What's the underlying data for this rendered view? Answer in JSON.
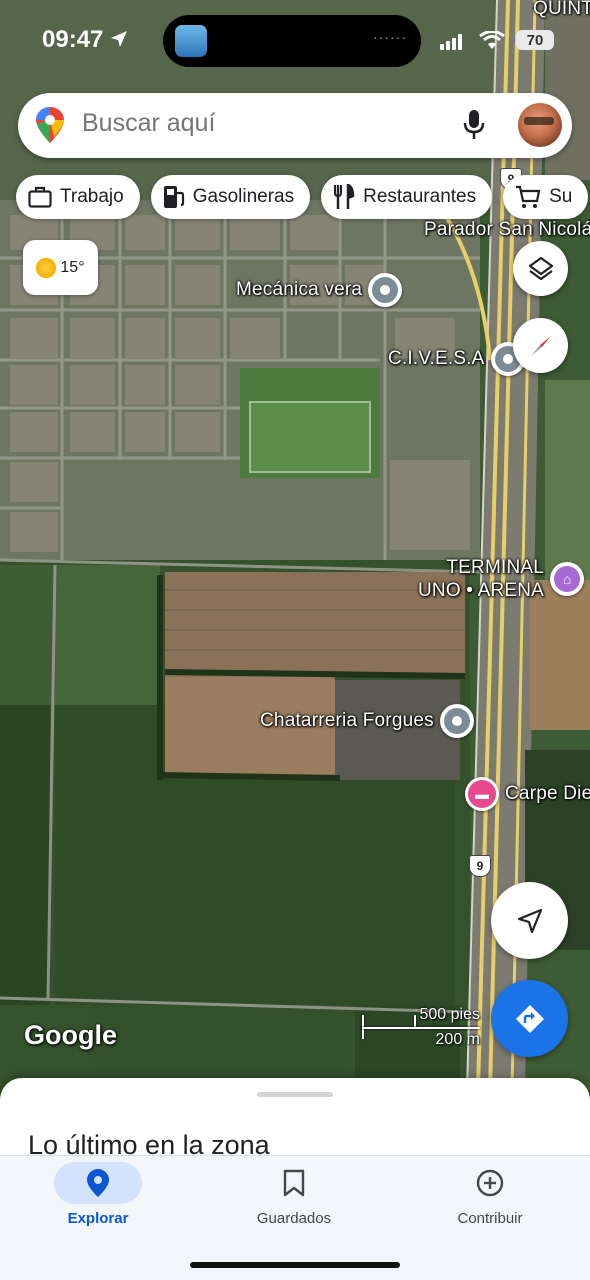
{
  "status_bar": {
    "time": "09:47",
    "battery": "70",
    "island_dots": "······"
  },
  "search": {
    "placeholder": "Buscar aquí"
  },
  "chips": [
    {
      "label": "Trabajo",
      "icon": "briefcase-icon"
    },
    {
      "label": "Gasolineras",
      "icon": "gas-station-icon"
    },
    {
      "label": "Restaurantes",
      "icon": "fork-knife-icon"
    },
    {
      "label": "Su",
      "icon": "cart-icon"
    }
  ],
  "weather": {
    "temperature": "15°"
  },
  "map": {
    "town_label": "QUINT",
    "places": [
      {
        "name": "Parador San Nicolás",
        "type": "label"
      },
      {
        "name": "Mecánica vera",
        "type": "gray-pin"
      },
      {
        "name": "C.I.V.E.S.A",
        "type": "gray-pin"
      },
      {
        "name": "TERMINAL",
        "name2": "UNO • ARENA",
        "type": "purple-pin"
      },
      {
        "name": "Chatarreria Forgues",
        "type": "gray-pin"
      },
      {
        "name": "Carpe Die",
        "type": "pink-pin"
      }
    ],
    "route_number": "9",
    "attribution": "Google",
    "scale_feet": "500 pies",
    "scale_meters": "200 m"
  },
  "sheet": {
    "title": "Lo último en la zona"
  },
  "bottom_nav": [
    {
      "label": "Explorar",
      "icon": "location-pin-icon",
      "active": true
    },
    {
      "label": "Guardados",
      "icon": "bookmark-icon",
      "active": false
    },
    {
      "label": "Contribuir",
      "icon": "plus-circle-icon",
      "active": false
    }
  ]
}
